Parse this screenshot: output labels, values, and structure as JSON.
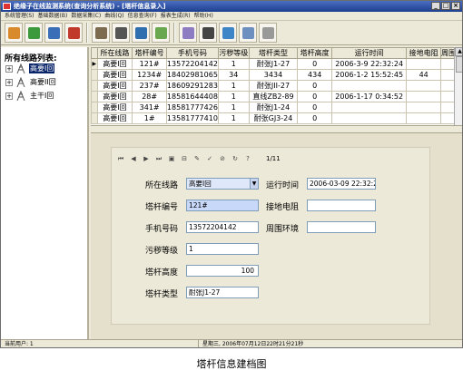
{
  "window": {
    "title": "绝缘子在线监测系统(查询分析系统) - [塔杆信息录入]",
    "buttons": [
      "_",
      "□",
      "×"
    ]
  },
  "menu": [
    "系统管理(S)",
    "基础数据(B)",
    "数据采集(C)",
    "曲线(Q)",
    "信息查询(F)",
    "报表生成(R)",
    "帮助(H)"
  ],
  "toolbar": {
    "icons": [
      "people-icon",
      "database-icon",
      "document-icon",
      "chart-icon",
      "tower-icon",
      "antenna-icon",
      "report-icon",
      "image-icon",
      "monitor-icon",
      "gauge-icon",
      "globe-icon",
      "mountain-icon",
      "help-icon"
    ],
    "colors": [
      "#d88a2c",
      "#3c9a3c",
      "#3a6fb8",
      "#c0392b",
      "#7d6b4f",
      "#555555",
      "#2f6fb0",
      "#6aa84f",
      "#8e7cc3",
      "#444444",
      "#3d85c6",
      "#6d8fbf",
      "#999999"
    ]
  },
  "sidebar": {
    "title": "所有线路列表:",
    "items": [
      {
        "label": "高要I回",
        "selected": true
      },
      {
        "label": "高要II回",
        "selected": false
      },
      {
        "label": "主干I回",
        "selected": false
      }
    ]
  },
  "grid": {
    "columns": [
      "所在线路",
      "塔杆编号",
      "手机号码",
      "污秽等级",
      "塔杆类型",
      "塔杆高度",
      "运行时间",
      "接地电阻",
      "周围环"
    ],
    "rows": [
      [
        "高要I回",
        "121#",
        "13572204142",
        "1",
        "耐张J1-27",
        "0",
        "2006-3-9 22:32:24",
        "",
        ""
      ],
      [
        "高要I回",
        "1234#",
        "18402981065",
        "34",
        "3434",
        "434",
        "2006-1-2 15:52:45",
        "44",
        ""
      ],
      [
        "高要I回",
        "237#",
        "18609291283",
        "1",
        "耐张JII-27",
        "0",
        "",
        "",
        ""
      ],
      [
        "高要I回",
        "28#",
        "18581644408",
        "1",
        "直线ZB2-89",
        "0",
        "2006-1-17 0:34:52",
        "",
        ""
      ],
      [
        "高要I回",
        "341#",
        "18581777426",
        "1",
        "耐张J1-24",
        "0",
        "",
        "",
        ""
      ],
      [
        "高要I回",
        "1#",
        "13581777410",
        "1",
        "耐张GJ3-24",
        "0",
        "",
        "",
        ""
      ]
    ]
  },
  "navigator": {
    "icons": [
      "first-icon",
      "prev-icon",
      "next-icon",
      "last-icon",
      "insert-icon",
      "delete-icon",
      "edit-icon",
      "post-icon",
      "cancel-icon",
      "refresh-icon",
      "help-icon"
    ],
    "glyphs": [
      "⏮",
      "◀",
      "▶",
      "⏭",
      "▣",
      "⊟",
      "✎",
      "✓",
      "⊘",
      "↻",
      "?"
    ],
    "record_count": "1/11"
  },
  "form": {
    "line_label": "所在线路",
    "line_value": "高要I回",
    "tower_no_label": "塔杆编号",
    "tower_no_value": "121#",
    "phone_label": "手机号码",
    "phone_value": "13572204142",
    "pollution_label": "污秽等级",
    "pollution_value": "1",
    "height_label": "塔杆高度",
    "height_value": "100",
    "type_label": "塔杆类型",
    "type_value": "耐张J1-27",
    "runtime_label": "运行时间",
    "runtime_value": "2006-03-09 22:32:24",
    "ground_label": "接地电阻",
    "ground_value": "",
    "env_label": "周围环境",
    "env_value": ""
  },
  "status": {
    "user": "当前用户: 1",
    "datetime": "星期三, 2006年07月12日22时21分21秒"
  },
  "caption": "塔杆信息建档图"
}
